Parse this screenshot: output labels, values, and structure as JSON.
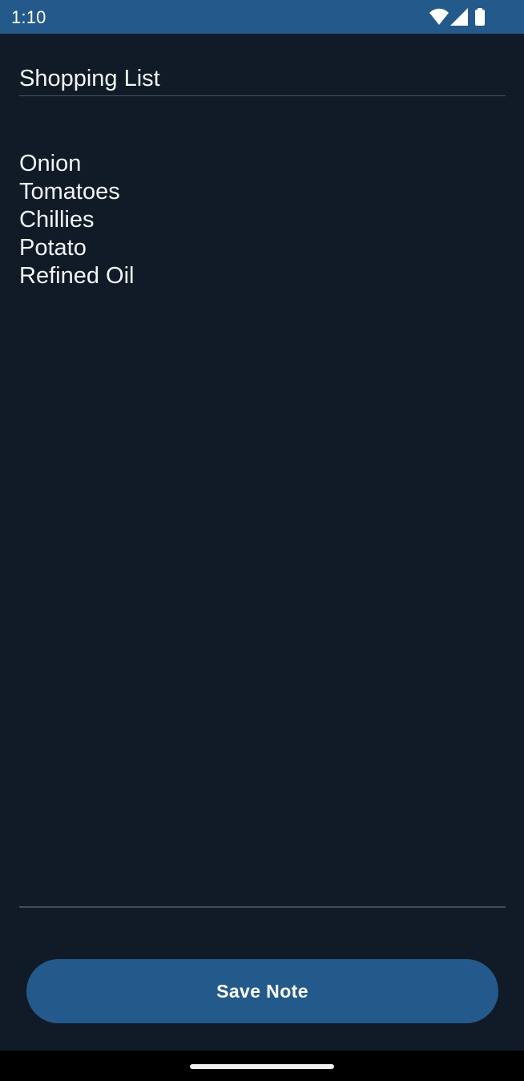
{
  "status_bar": {
    "time": "1:10",
    "icons": [
      "wifi-icon",
      "cellular-signal-icon",
      "battery-icon"
    ],
    "background": "#245a8b"
  },
  "note": {
    "title": "Shopping List",
    "lines": [
      "Onion",
      "Tomatoes",
      "Chillies",
      "Potato",
      "Refined Oil"
    ]
  },
  "actions": {
    "save_label": "Save Note"
  },
  "colors": {
    "background": "#111b27",
    "accent": "#245a8b",
    "text": "#f3f5f7"
  }
}
